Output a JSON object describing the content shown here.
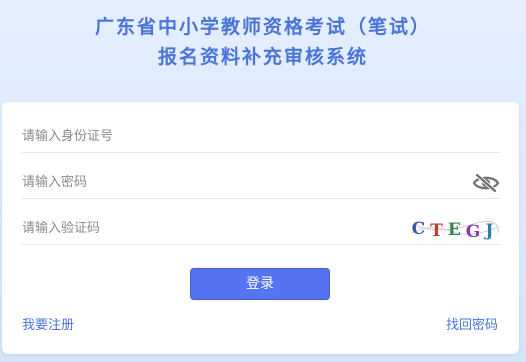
{
  "header": {
    "title_line1": "广东省中小学教师资格考试（笔试）",
    "title_line2": "报名资料补充审核系统"
  },
  "form": {
    "id_placeholder": "请输入身份证号",
    "password_placeholder": "请输入密码",
    "captcha_placeholder": "请输入验证码",
    "captcha_text": "CTEGJ",
    "password_toggle_icon": "eye-slash-icon",
    "login_label": "登录"
  },
  "links": {
    "register": "我要注册",
    "forgot_password": "找回密码"
  },
  "colors": {
    "accent": "#4a74d8",
    "button": "#5474f1",
    "background": "#dbe9fd"
  }
}
